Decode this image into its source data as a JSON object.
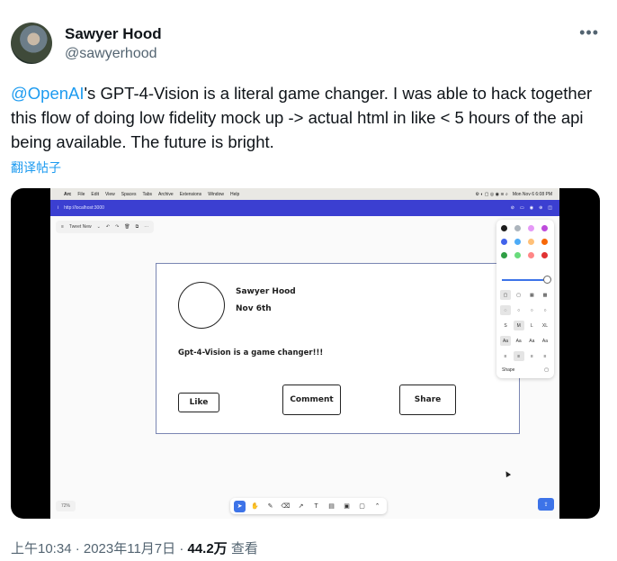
{
  "author": {
    "name": "Sawyer Hood",
    "handle": "@sawyerhood"
  },
  "tweet": {
    "mention": "@OpenAI",
    "body": "'s  GPT-4-Vision is a literal game changer. I was able to hack together this flow of doing low fidelity mock up -> actual html in like < 5 hours of the api being available. The future is bright.",
    "translate": "翻译帖子"
  },
  "screenshot": {
    "menubar": {
      "items": [
        "Arc",
        "File",
        "Edit",
        "View",
        "Spaces",
        "Tabs",
        "Archive",
        "Extensions",
        "Window",
        "Help"
      ],
      "clock": "Mon Nov 6 6:08 PM"
    },
    "address": "http://localhost:3000",
    "doc_menu": "Tweet New",
    "mockup": {
      "name": "Sawyer Hood",
      "date": "Nov 6th",
      "text": "Gpt-4-Vision is a game changer!!!",
      "like": "Like",
      "comment": "Comment",
      "share": "Share"
    },
    "props": {
      "colors": [
        "#1e1e1e",
        "#adb5bd",
        "#e599f7",
        "#be4bdb",
        "#4263eb",
        "#4dabf7",
        "#ffc078",
        "#f76707",
        "#2f9e44",
        "#69db7c",
        "#ff8787",
        "#e03131"
      ],
      "sizes": [
        "S",
        "M",
        "L",
        "XL"
      ],
      "fonts": [
        "Aa",
        "Aa",
        "Aa",
        "Aa"
      ],
      "shape_label": "Shape"
    },
    "zoom": "72%"
  },
  "meta": {
    "time": "上午10:34 · 2023年11月7日 · ",
    "views": "44.2万",
    "views_label": " 查看"
  }
}
